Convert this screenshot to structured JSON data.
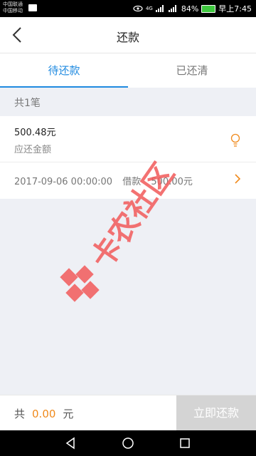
{
  "status_bar": {
    "carrier_line1": "中国联通",
    "carrier_line2": "中国移动",
    "network": "4G",
    "battery": "84%",
    "time": "早上7:45"
  },
  "header": {
    "title": "还款"
  },
  "tabs": [
    {
      "label": "待还款",
      "active": true
    },
    {
      "label": "已还清",
      "active": false
    }
  ],
  "summary": {
    "count_text": "共1笔"
  },
  "loan": {
    "amount": "500.48元",
    "amount_label": "应还金额",
    "date": "2017-09-06 00:00:00",
    "type": "借款",
    "principal": "500.00元"
  },
  "watermark": {
    "text": "卡农社区"
  },
  "footer": {
    "total_prefix": "共",
    "total_amount": "0.00",
    "total_unit": "元",
    "pay_button": "立即还款"
  },
  "colors": {
    "accent": "#1f8ae0",
    "orange": "#f08a1c",
    "watermark": "#f25a5a"
  }
}
